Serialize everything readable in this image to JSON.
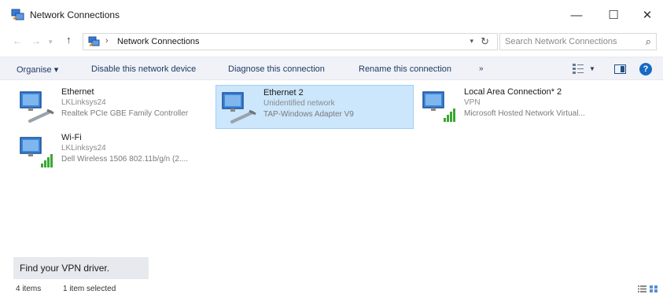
{
  "window": {
    "title": "Network Connections",
    "controls": {
      "minimize": "—",
      "maximize": "☐",
      "close": "✕"
    }
  },
  "address_bar": {
    "back": "←",
    "forward": "→",
    "up": "↑",
    "separator": "›",
    "path": "Network Connections",
    "search_placeholder": "Search Network Connections"
  },
  "toolbar": {
    "organise": "Organise ▾",
    "disable": "Disable this network device",
    "diagnose": "Diagnose this connection",
    "rename": "Rename this connection",
    "more": "»"
  },
  "connections": [
    {
      "name": "Ethernet",
      "status": "LKLinksys24",
      "device": "Realtek PCIe GBE Family Controller",
      "icon": "ethernet-adapter-icon",
      "selected": false
    },
    {
      "name": "Ethernet 2",
      "status": "Unidentified network",
      "device": "TAP-Windows Adapter V9",
      "icon": "ethernet-adapter-icon",
      "selected": true
    },
    {
      "name": "Local Area Connection* 2",
      "status": "VPN",
      "device": "Microsoft Hosted Network Virtual...",
      "icon": "wifi-adapter-icon",
      "selected": false
    },
    {
      "name": "Wi-Fi",
      "status": "LKLinksys24",
      "device": "Dell Wireless 1506 802.11b/g/n (2....",
      "icon": "wifi-adapter-icon",
      "selected": false
    }
  ],
  "tooltip": {
    "text": "Find your VPN driver."
  },
  "status_bar": {
    "item_count": "4 items",
    "selection": "1 item selected"
  },
  "colors": {
    "selection": "#cce6fb",
    "toolbar_bg": "#f0f2f7",
    "accent": "#1769c4"
  }
}
